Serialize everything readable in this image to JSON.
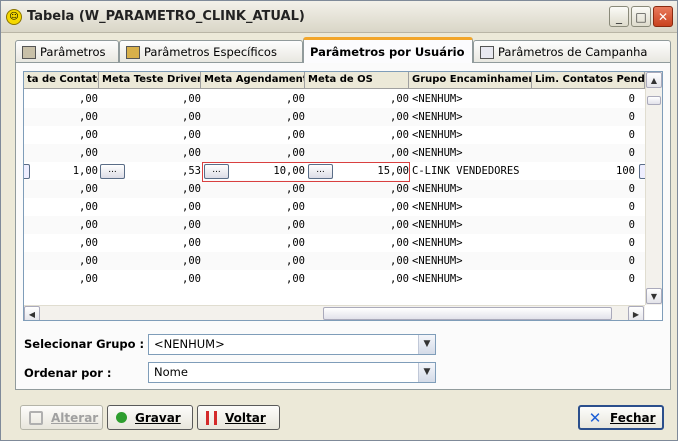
{
  "window": {
    "title": "Tabela (W_PARAMETRO_CLINK_ATUAL)",
    "minimize": "_",
    "maximize": "□",
    "close": "✕"
  },
  "tabs": [
    {
      "label": "Parâmetros",
      "icon": "grid-icon"
    },
    {
      "label": "Parâmetros Específicos",
      "icon": "key-icon"
    },
    {
      "label": "Parâmetros por Usuário",
      "active": true
    },
    {
      "label": "Parâmetros de Campanha",
      "icon": "table-icon"
    }
  ],
  "grid": {
    "columns": [
      "ta de Contatos",
      "Meta Teste Driver",
      "Meta Agendamento",
      "Meta de OS",
      "Grupo Encaminhamento",
      "Lim. Contatos Pend."
    ],
    "cell_button": "...",
    "rows": [
      {
        "contatos": ",00",
        "driver": ",00",
        "agendamento": ",00",
        "os": ",00",
        "grupo": "<NENHUM>",
        "lim": "0"
      },
      {
        "contatos": ",00",
        "driver": ",00",
        "agendamento": ",00",
        "os": ",00",
        "grupo": "<NENHUM>",
        "lim": "0"
      },
      {
        "contatos": ",00",
        "driver": ",00",
        "agendamento": ",00",
        "os": ",00",
        "grupo": "<NENHUM>",
        "lim": "0"
      },
      {
        "contatos": ",00",
        "driver": ",00",
        "agendamento": ",00",
        "os": ",00",
        "grupo": "<NENHUM>",
        "lim": "0"
      },
      {
        "contatos": "1,00",
        "driver": ",53",
        "agendamento": "10,00",
        "os": "15,00",
        "grupo": "C-LINK VENDEDORES",
        "lim": "100",
        "selected": true
      },
      {
        "contatos": ",00",
        "driver": ",00",
        "agendamento": ",00",
        "os": ",00",
        "grupo": "<NENHUM>",
        "lim": "0"
      },
      {
        "contatos": ",00",
        "driver": ",00",
        "agendamento": ",00",
        "os": ",00",
        "grupo": "<NENHUM>",
        "lim": "0"
      },
      {
        "contatos": ",00",
        "driver": ",00",
        "agendamento": ",00",
        "os": ",00",
        "grupo": "<NENHUM>",
        "lim": "0"
      },
      {
        "contatos": ",00",
        "driver": ",00",
        "agendamento": ",00",
        "os": ",00",
        "grupo": "<NENHUM>",
        "lim": "0"
      },
      {
        "contatos": ",00",
        "driver": ",00",
        "agendamento": ",00",
        "os": ",00",
        "grupo": "<NENHUM>",
        "lim": "0"
      },
      {
        "contatos": ",00",
        "driver": ",00",
        "agendamento": ",00",
        "os": ",00",
        "grupo": "<NENHUM>",
        "lim": "0"
      }
    ]
  },
  "filters": {
    "grupo_label": "Selecionar Grupo :",
    "grupo_value": "<NENHUM>",
    "ordenar_label": "Ordenar por :",
    "ordenar_value": "Nome"
  },
  "buttons": {
    "alterar": "Alterar",
    "gravar": "Gravar",
    "voltar": "Voltar",
    "fechar": "Fechar"
  },
  "colors": {
    "accent": "#f2a62a",
    "highlight": "#d94040",
    "gravar": "#2e9e2e",
    "voltar": "#d42a2a",
    "fechar": "#1d5fd6"
  }
}
